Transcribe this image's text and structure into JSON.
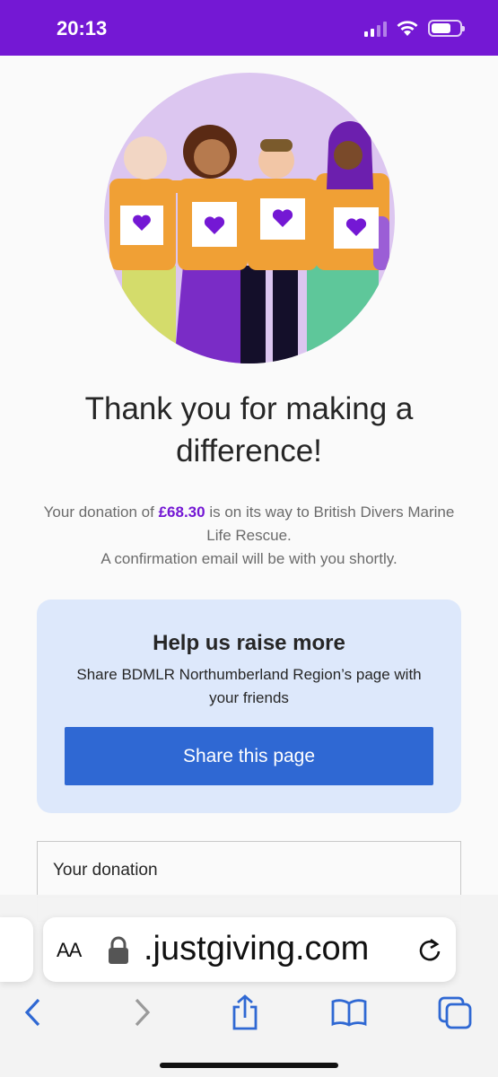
{
  "status_bar": {
    "time": "20:13",
    "signal_bars": 2,
    "battery_level": 0.7,
    "icons": [
      "signal-icon",
      "wifi-icon",
      "battery-icon"
    ],
    "color": "#7418d4"
  },
  "hero": {
    "icon": "heart-icon",
    "colors": {
      "background": "#dcc6f0",
      "shirt": "#f0a035",
      "heart": "#7418d4"
    }
  },
  "thank_you": {
    "title": "Thank you for making a difference!",
    "message_prefix": "Your donation of ",
    "amount": "£68.30",
    "message_suffix": " is on its way to British Divers Marine Life Rescue.",
    "confirmation": "A confirmation email will be with you shortly."
  },
  "share": {
    "title": "Help us raise more",
    "subtitle": "Share BDMLR Northumberland Region’s page with your friends",
    "button_label": "Share this page",
    "button_color": "#2f68d3",
    "card_color": "#dde8fb"
  },
  "donation": {
    "heading": "Your donation"
  },
  "browser": {
    "aa_label": "AA",
    "url": ".justgiving.com",
    "toolbar_icons": [
      "back-icon",
      "forward-icon",
      "share-icon",
      "bookmarks-icon",
      "tabs-icon"
    ]
  }
}
